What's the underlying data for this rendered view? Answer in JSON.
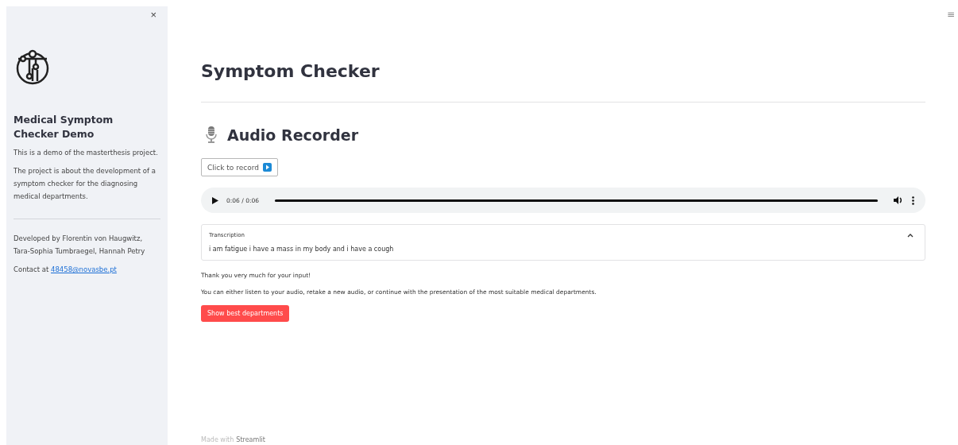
{
  "sidebar": {
    "close": "×",
    "title": "Medical Symptom Checker Demo",
    "paragraphs": [
      "This is a demo of the masterthesis project.",
      "The project is about the development of a symptom checker for the diagnosing medical departments."
    ],
    "credits": "Developed by Florentin von Haugwitz, Tara-Sophia Tumbraegel, Hannah Petry",
    "contact": {
      "text": "Contact at ",
      "link": "48458@novasbe.pt"
    }
  },
  "menu": "≡",
  "title": "Symptom Checker",
  "section": "Audio Recorder",
  "record_button": "Click to record",
  "player": {
    "time": "0:06 / 0:06",
    "level": 1
  },
  "expander": {
    "label": "Transcription",
    "expanded": true,
    "text": "i am fatigue i have a mass in my body and i have a cough"
  },
  "messages": [
    "Thank you very much for your input!",
    "You can either listen to your audio, retake a new audio, or continue with the presentation of the most suitable medical departments."
  ],
  "action_button": "Show best departments",
  "footer": {
    "prefix": "Made with",
    "brand": "Streamlit"
  }
}
